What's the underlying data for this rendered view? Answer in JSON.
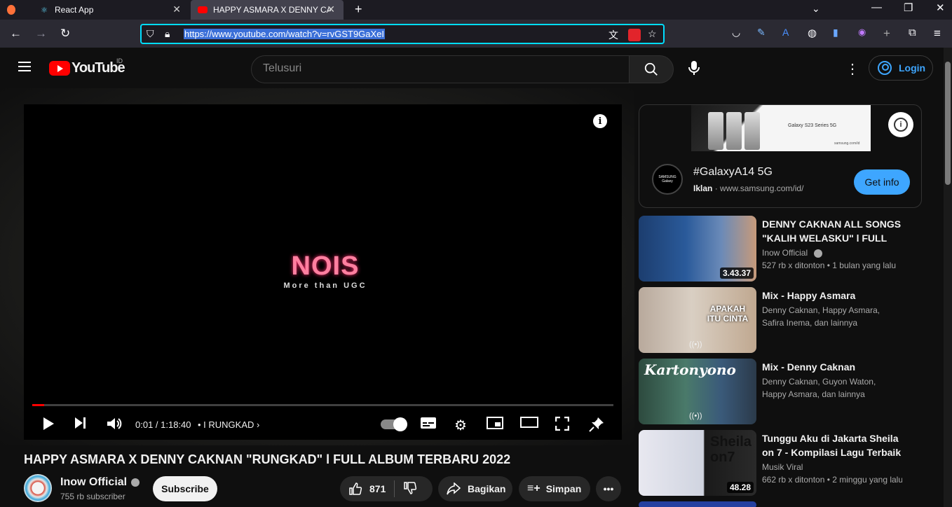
{
  "browser": {
    "tabs": [
      {
        "label": "React App"
      },
      {
        "label": "HAPPY ASMARA X DENNY CAKNAN"
      }
    ],
    "url": "https://www.youtube.com/watch?v=rvGST9GaXeI"
  },
  "header": {
    "logo_text": "YouTube",
    "country_code": "ID",
    "search_placeholder": "Telusuri",
    "login_label": "Login"
  },
  "player": {
    "overlay_brand": "NOIS",
    "overlay_tagline": "More than UGC",
    "progress": 0.02,
    "time": "0:01 / 1:18:40",
    "chapter": "• I RUNGKAD"
  },
  "video": {
    "title": "HAPPY ASMARA X DENNY CAKNAN \"RUNGKAD\" l FULL ALBUM TERBARU 2022",
    "channel": "Inow Official",
    "subscribers": "755 rb subscriber",
    "subscribe_label": "Subscribe",
    "likes": "871",
    "share_label": "Bagikan",
    "save_label": "Simpan"
  },
  "ad": {
    "banner_product": "Galaxy S23 Series 5G",
    "banner_site": "samsung.com/id",
    "logo_text": "SAMSUNG Galaxy",
    "title": "#GalaxyA14 5G",
    "label": "Iklan",
    "url": "www.samsung.com/id/",
    "cta": "Get info"
  },
  "recommendations": [
    {
      "title": "DENNY CAKNAN ALL SONGS \"KALIH WELASKU\" l FULL ALBUM",
      "channel": "Inow Official",
      "meta": "527 rb x ditonton  • 1 bulan yang lalu",
      "duration": "3.43.37"
    },
    {
      "title": "Mix - Happy Asmara",
      "channel": "Denny Caknan, Happy Asmara, Safira Inema, dan lainnya",
      "meta": "",
      "thumb_text": "APAKAH ITU CINTA"
    },
    {
      "title": "Mix - Denny Caknan",
      "channel": "Denny Caknan, Guyon Waton, Happy Asmara, dan lainnya",
      "meta": "",
      "thumb_text": "Kartonyono"
    },
    {
      "title": "Tunggu Aku di Jakarta Sheila on 7 - Kompilasi Lagu Terbaik",
      "channel": "Musik Viral",
      "meta": "662 rb x ditonton  • 2 minggu yang lalu",
      "duration": "48.28",
      "thumb_text": "Sheila on7"
    }
  ]
}
